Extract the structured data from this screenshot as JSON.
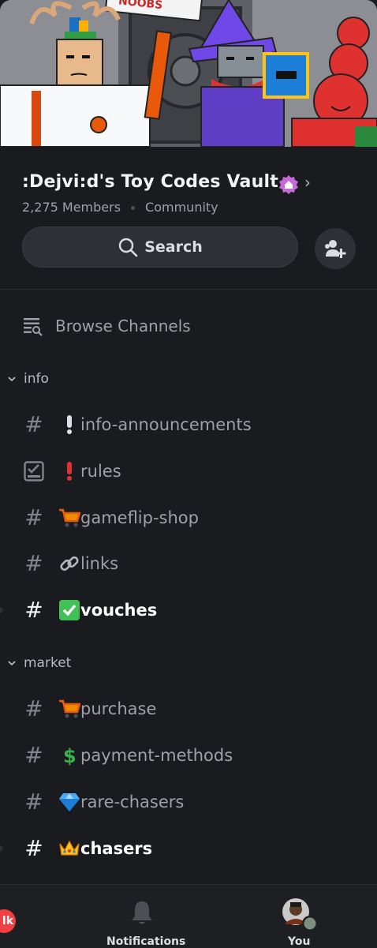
{
  "server": {
    "name": ":Dejvi:d's Toy Codes Vault",
    "members": "2,275 Members",
    "type": "Community",
    "banner_sign": "NOOBS"
  },
  "search": {
    "label": "Search"
  },
  "browse": {
    "label": "Browse Channels"
  },
  "categories": [
    {
      "name": "info",
      "channels": [
        {
          "icon": "hash",
          "emoji": "exclamation-grey",
          "name": "info-announcements",
          "unread": false
        },
        {
          "icon": "rules-checkbox",
          "emoji": "exclamation-red",
          "name": "rules",
          "unread": false
        },
        {
          "icon": "hash",
          "emoji": "shopping-cart",
          "name": "gameflip-shop",
          "unread": false
        },
        {
          "icon": "hash",
          "emoji": "link",
          "name": "links",
          "unread": false
        },
        {
          "icon": "hash",
          "emoji": "check-mark",
          "name": "vouches",
          "unread": true
        }
      ]
    },
    {
      "name": "market",
      "channels": [
        {
          "icon": "hash",
          "emoji": "shopping-cart",
          "name": "purchase",
          "unread": false
        },
        {
          "icon": "hash",
          "emoji": "dollar-sign",
          "name": "payment-methods",
          "unread": false
        },
        {
          "icon": "hash",
          "emoji": "gem",
          "name": "rare-chasers",
          "unread": false
        },
        {
          "icon": "hash",
          "emoji": "crown",
          "name": "chasers",
          "unread": true
        }
      ]
    }
  ],
  "nav": {
    "badge": "lk",
    "notifications": "Notifications",
    "you": "You"
  },
  "colors": {
    "background": "#1a1b1f",
    "unread_text": "#ffffff",
    "read_text": "#9ea2a8",
    "boost_pink": "#c768d9",
    "badge_red": "#f23f43",
    "status_green": "#7a8f7d"
  }
}
